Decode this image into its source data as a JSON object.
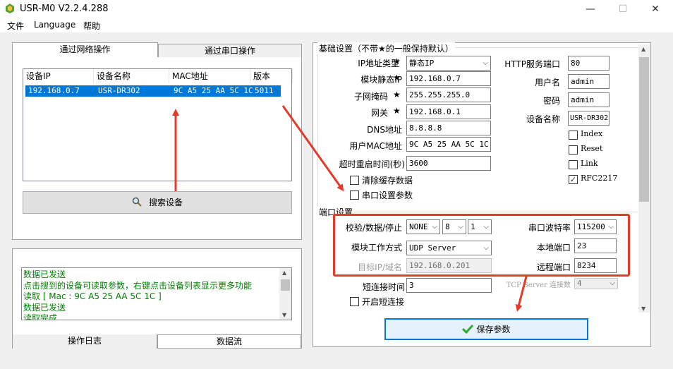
{
  "window": {
    "title": "USR-M0 V2.2.4.288",
    "minimize": "—",
    "maximize": "☐",
    "close": "✕"
  },
  "menu": [
    "文件",
    "Language",
    "帮助"
  ],
  "left_tabs": {
    "network": "通过网络操作",
    "serial": "通过串口操作"
  },
  "device_table": {
    "columns": [
      "设备IP",
      "设备名称",
      "MAC地址",
      "版本"
    ],
    "rows": [
      {
        "ip": "192.168.0.7",
        "name": "USR-DR302",
        "mac": "9C A5 25 AA 5C 1C",
        "version": "5011"
      }
    ]
  },
  "search_button": "搜索设备",
  "log": {
    "lines": [
      "数据已发送",
      "点击搜到的设备可读取参数，右键点击设备列表显示更多功能",
      "读取 [ Mac : 9C A5 25 AA 5C 1C ]",
      "数据已发送",
      "读取完成"
    ],
    "tabs": {
      "log": "操作日志",
      "stream": "数据流"
    }
  },
  "basic": {
    "title": "基础设置（不带★的一般保持默认）",
    "ip_type_label": "IP地址类型",
    "ip_type_value": "静态IP",
    "static_ip_label": "模块静态IP",
    "static_ip_value": "192.168.0.7",
    "mask_label": "子网掩码",
    "mask_value": "255.255.255.0",
    "gateway_label": "网关",
    "gateway_value": "192.168.0.1",
    "dns_label": "DNS地址",
    "dns_value": "8.8.8.8",
    "mac_label": "用户MAC地址",
    "mac_value": "9C A5 25 AA 5C 1C",
    "reboot_label": "超时重启时间(秒)",
    "reboot_value": "3600",
    "clear_cache_label": "清除缓存数据",
    "serial_params_label": "串口设置参数",
    "http_port_label": "HTTP服务端口",
    "http_port_value": "80",
    "username_label": "用户名",
    "username_value": "admin",
    "password_label": "密码",
    "password_value": "admin",
    "device_name_label": "设备名称",
    "device_name_value": "USR-DR302",
    "index_label": "Index",
    "reset_label": "Reset",
    "link_label": "Link",
    "rfc_label": "RFC2217",
    "star": "★"
  },
  "serial": {
    "title": "端口设置",
    "parity_label": "校验/数据/停止",
    "parity_value": "NONE",
    "data_bits": "8",
    "stop_bits": "1",
    "baud_label": "串口波特率",
    "baud_value": "115200",
    "mode_label": "模块工作方式",
    "mode_value": "UDP Server",
    "local_port_label": "本地端口",
    "local_port_value": "23",
    "target_label": "目标IP/域名",
    "target_value": "192.168.0.201",
    "remote_port_label": "远程端口",
    "remote_port_value": "8234",
    "short_conn_label": "短连接时间",
    "short_conn_value": "3",
    "tcp_conn_label": "TCP Server 连接数",
    "tcp_conn_value": "4",
    "enable_short_label": "开启短连接"
  },
  "save_button": "保存参数",
  "colors": {
    "accent": "#0078d7",
    "annotation": "#e53a2a",
    "log_text": "#008000"
  }
}
